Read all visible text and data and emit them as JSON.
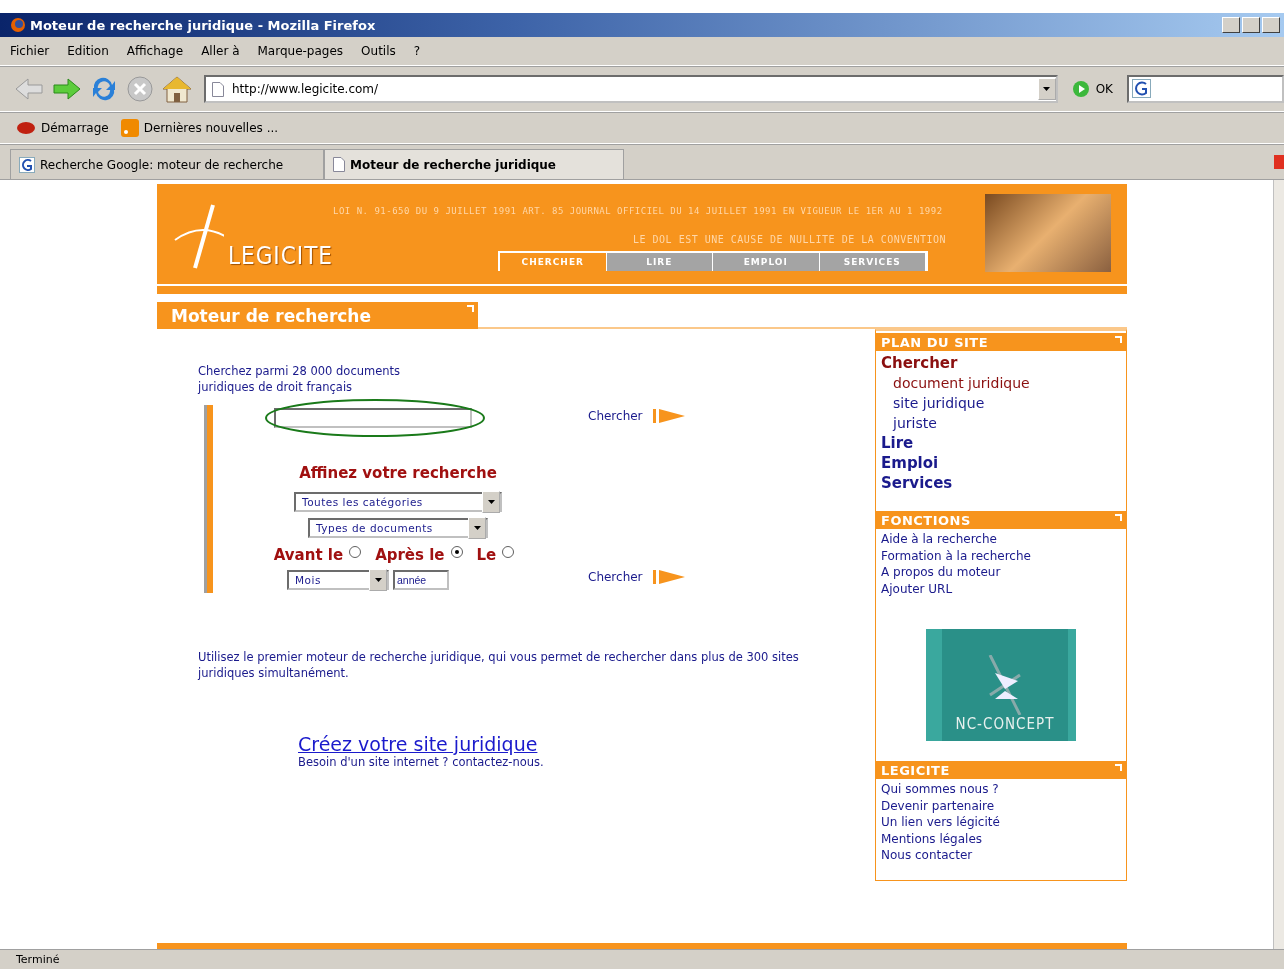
{
  "window": {
    "title": "Moteur de recherche juridique - Mozilla Firefox"
  },
  "menu": [
    "Fichier",
    "Edition",
    "Affichage",
    "Aller à",
    "Marque-pages",
    "Outils",
    "?"
  ],
  "address": {
    "value": "http://www.legicite.com/",
    "go_label": "OK"
  },
  "bookmarks": [
    "Démarrage",
    "Dernières nouvelles ..."
  ],
  "tabs": [
    {
      "label": "Recherche Google: moteur de recherche",
      "selected": false
    },
    {
      "label": "Moteur de recherche juridique",
      "selected": true
    }
  ],
  "banner": {
    "logo": "LEGICITE",
    "lines": [
      "LOI N. 91-650 DU 9 JUILLET 1991 ART. 85 JOURNAL OFFICIEL DU 14 JUILLET 1991 EN VIGUEUR LE 1ER AU 1 1992",
      "LE DOL EST UNE CAUSE DE NULLITE DE LA CONVENTION"
    ],
    "nav": [
      {
        "label": "CHERCHER",
        "selected": true
      },
      {
        "label": "LIRE",
        "selected": false
      },
      {
        "label": "EMPLOI",
        "selected": false
      },
      {
        "label": "SERVICES",
        "selected": false
      }
    ]
  },
  "heading": "Moteur de recherche",
  "search": {
    "intro": "Cherchez parmi 28 000 documents juridiques de droit français",
    "submit": "Chercher",
    "refine_title": "Affinez votre recherche",
    "selects": [
      "Toutes les catégories",
      "Types de documents"
    ],
    "date_options": [
      {
        "label": "Avant le",
        "selected": false
      },
      {
        "label": "Après le",
        "selected": true
      },
      {
        "label": "Le",
        "selected": false
      }
    ],
    "month": "Mois",
    "year_placeholder": "année",
    "submit_2": "Chercher"
  },
  "description": "Utilisez le premier moteur de recherche juridique, qui vous permet de rechercher dans plus de 300 sites juridiques simultanément.",
  "promo": {
    "link": "Créez votre site juridique",
    "text": "Besoin d'un site internet ? contactez-nous."
  },
  "sidebar": {
    "plan_title": "PLAN DU SITE",
    "plan": [
      {
        "label": "Chercher",
        "selected": true,
        "children": [
          {
            "label": "document juridique",
            "selected": true
          },
          {
            "label": "site juridique",
            "selected": false
          },
          {
            "label": "juriste",
            "selected": false
          }
        ]
      },
      {
        "label": "Lire",
        "selected": false
      },
      {
        "label": "Emploi",
        "selected": false
      },
      {
        "label": "Services",
        "selected": false
      }
    ],
    "functions_title": "FONCTIONS",
    "functions": [
      "Aide à la recherche",
      "Formation à la recherche",
      "A propos du moteur",
      "Ajouter URL"
    ],
    "ad": "NC-CONCEPT",
    "legicite_title": "LEGICITE",
    "legicite": [
      "Qui sommes nous ?",
      "Devenir partenaire",
      "Un lien vers légicité",
      "Mentions légales",
      "Nous contacter"
    ]
  },
  "status_bar": "Terminé"
}
